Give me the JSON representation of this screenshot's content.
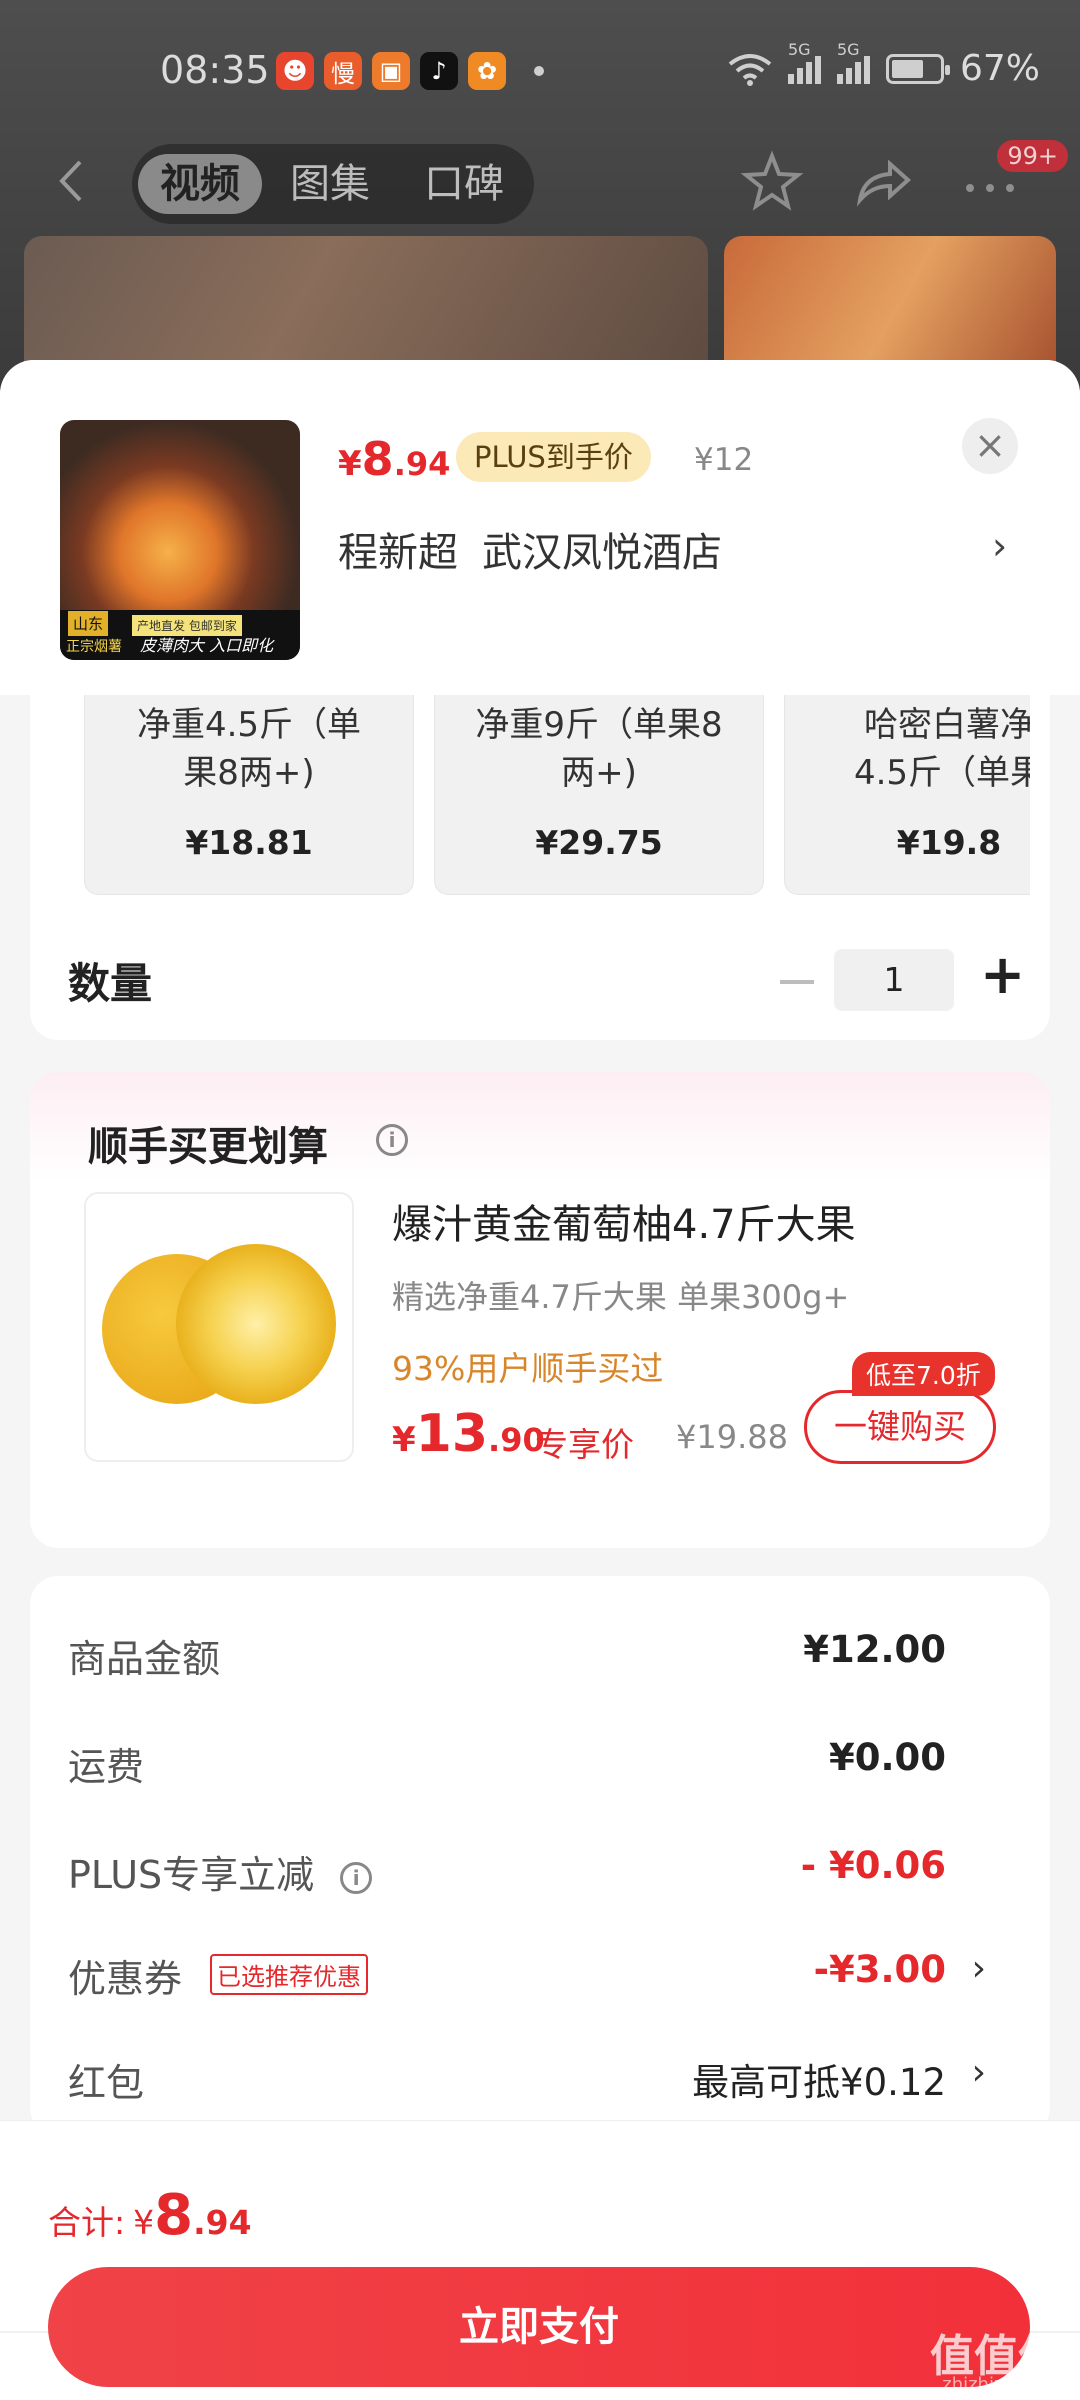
{
  "status_bar": {
    "time": "08:35",
    "battery": "67%",
    "network_1": "5G",
    "network_2": "5G"
  },
  "nav": {
    "tabs": [
      {
        "label": "视频",
        "active": true
      },
      {
        "label": "图集",
        "active": false
      },
      {
        "label": "口碑",
        "active": false
      }
    ],
    "badge": "99+"
  },
  "product": {
    "price_currency": "¥",
    "price_int": "8",
    "price_dec": ".94",
    "plus_label": "PLUS到手价",
    "original_price": "¥12",
    "close_icon": "×",
    "shop_names": [
      "程新超",
      "武汉凤悦酒店"
    ],
    "thumb_labels": [
      "山东",
      "产地直发 包邮到家",
      "正宗烟薯",
      "皮薄肉大 入口即化"
    ]
  },
  "variants": [
    {
      "name": "净重4.5斤（单\n果8两+)",
      "price": "¥18.81"
    },
    {
      "name": "净重9斤（单果8\n两+)",
      "price": "¥29.75"
    },
    {
      "name": "哈密白薯净\n4.5斤（单果",
      "price": "¥19.8"
    }
  ],
  "quantity": {
    "label": "数量",
    "value": "1"
  },
  "upsell": {
    "title": "顺手买更划算",
    "name": "爆汁黄金葡萄柚4.7斤大果",
    "desc": "精选净重4.7斤大果 单果300g+",
    "social": "93%用户顺手买过",
    "price_currency": "¥",
    "price_int": "13",
    "price_dec": ".90",
    "exclusive": "专享价",
    "original_price": "¥19.88",
    "discount_tag": "低至7.0折",
    "buy_label": "一键购买"
  },
  "summary": {
    "goods_label": "商品金额",
    "goods_value": "¥12.00",
    "shipping_label": "运费",
    "shipping_value": "¥0.00",
    "plus_label": "PLUS专享立减",
    "plus_value": "- ¥0.06",
    "coupon_label": "优惠券",
    "coupon_tag": "已选推荐优惠",
    "coupon_value": "-¥3.00",
    "redpacket_label": "红包",
    "redpacket_value": "最高可抵¥0.12"
  },
  "bottom": {
    "total_label": "合计:",
    "total_currency": "¥",
    "total_int": "8",
    "total_dec": ".94",
    "pay_label": "立即支付"
  },
  "watermark": {
    "text": "值值值",
    "sub": "zhizhizhi.com"
  },
  "colors": {
    "accent_red": "#e4282c",
    "plus_badge_bg": "#fbe9b8",
    "social_orange": "#d8862a"
  }
}
